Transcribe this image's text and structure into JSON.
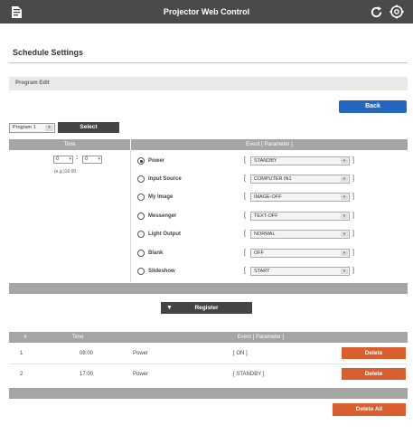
{
  "app": {
    "title": "Projector Web Control"
  },
  "page": {
    "title": "Schedule Settings",
    "section": "Program Edit"
  },
  "actions": {
    "back": "Back",
    "select": "Select",
    "register": "Register",
    "delete_all": "Delete All"
  },
  "program": {
    "selected": "Program 1"
  },
  "event_table": {
    "headers": {
      "time": "Time",
      "event": "Event [ Parameter ]"
    },
    "time": {
      "hour": "0",
      "minute": "0",
      "separator": ":",
      "example": "(e.g.)16:00"
    },
    "events": [
      {
        "label": "Power",
        "value": "STANDBY",
        "selected": true
      },
      {
        "label": "Input Source",
        "value": "COMPUTER IN1",
        "selected": false
      },
      {
        "label": "My Image",
        "value": "IMAGE-OFF",
        "selected": false
      },
      {
        "label": "Messenger",
        "value": "TEXT-OFF",
        "selected": false
      },
      {
        "label": "Light Output",
        "value": "NORMAL",
        "selected": false
      },
      {
        "label": "Blank",
        "value": "OFF",
        "selected": false
      },
      {
        "label": "Slideshow",
        "value": "START",
        "selected": false
      }
    ],
    "bracket_open": "[",
    "bracket_close": "]"
  },
  "schedule_list": {
    "headers": {
      "num": "#",
      "time": "Time",
      "event": "Event [ Parameter ]"
    },
    "rows": [
      {
        "num": "1",
        "time": "08:00",
        "event": "Power",
        "param": "[ ON ]",
        "action": "Delete"
      },
      {
        "num": "2",
        "time": "17:00",
        "event": "Power",
        "param": "[ STANDBY ]",
        "action": "Delete"
      }
    ]
  },
  "icons": {
    "menu": "menu-icon",
    "refresh": "refresh-icon",
    "settings": "gear-icon",
    "register": "triangle-down-icon"
  },
  "colors": {
    "topbar": "#4a4a4a",
    "header_grey": "#a5a5a5",
    "back_blue": "#2566c1",
    "delete_orange": "#d95f2f",
    "dark_button": "#444444"
  }
}
